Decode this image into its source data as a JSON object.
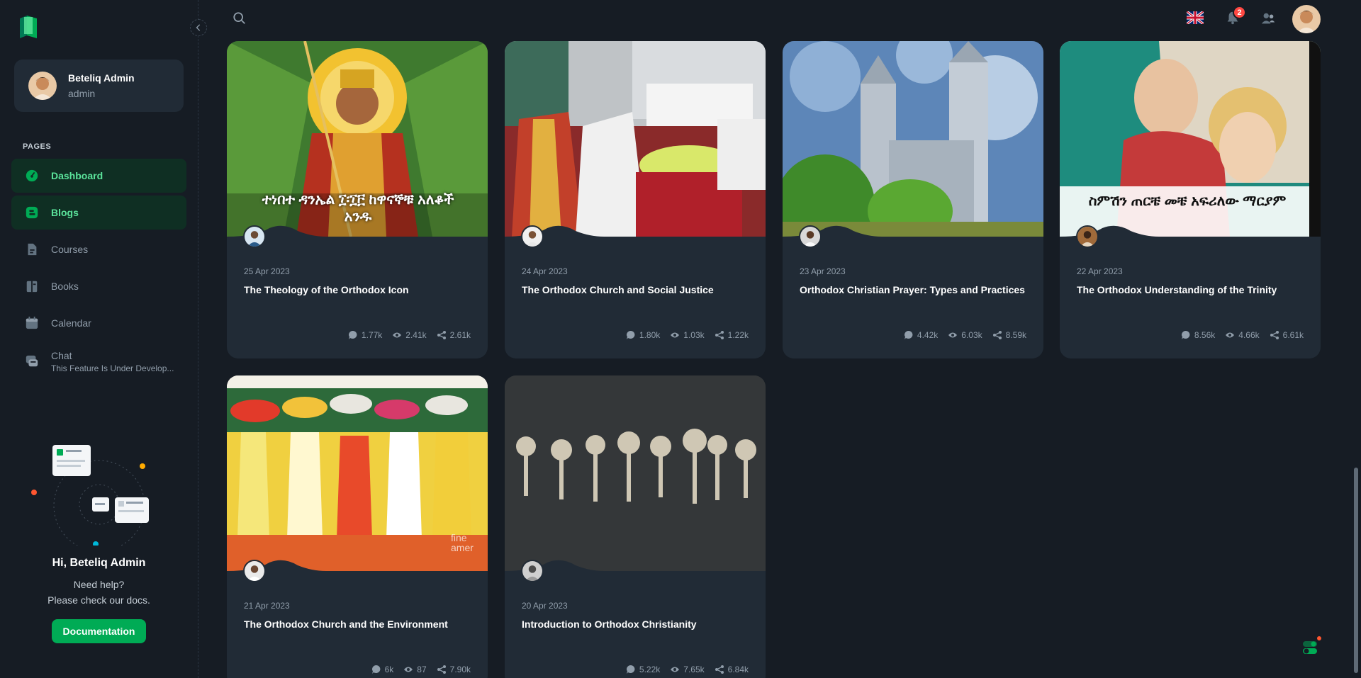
{
  "sidebar": {
    "account": {
      "name": "Beteliq Admin",
      "role": "admin"
    },
    "section_label": "PAGES",
    "items": [
      {
        "label": "Dashboard",
        "icon": "dashboard-icon",
        "active": true
      },
      {
        "label": "Blogs",
        "icon": "blog-icon",
        "active": true
      },
      {
        "label": "Courses",
        "icon": "courses-icon",
        "active": false
      },
      {
        "label": "Books",
        "icon": "books-icon",
        "active": false
      },
      {
        "label": "Calendar",
        "icon": "calendar-icon",
        "active": false
      },
      {
        "label": "Chat",
        "sub": "This Feature Is Under Develop...",
        "icon": "chat-icon",
        "active": false
      }
    ],
    "help": {
      "title": "Hi, Beteliq Admin",
      "line1": "Need help?",
      "line2": "Please check our docs.",
      "button": "Documentation"
    }
  },
  "topbar": {
    "notification_count": "2",
    "language": "English (UK flag)"
  },
  "posts": [
    {
      "date": "25 Apr 2023",
      "title": "The Theology of the Orthodox Icon",
      "comments": "1.77k",
      "views": "2.41k",
      "shares": "2.61k",
      "image_text": "ተነበተ ዳንኤል ፲፡፲፫ ከዋናኞቹ አለቆች አንዱ"
    },
    {
      "date": "24 Apr 2023",
      "title": "The Orthodox Church and Social Justice",
      "comments": "1.80k",
      "views": "1.03k",
      "shares": "1.22k"
    },
    {
      "date": "23 Apr 2023",
      "title": "Orthodox Christian Prayer: Types and Practices",
      "comments": "4.42k",
      "views": "6.03k",
      "shares": "8.59k"
    },
    {
      "date": "22 Apr 2023",
      "title": "The Orthodox Understanding of the Trinity",
      "comments": "8.56k",
      "views": "4.66k",
      "shares": "6.61k",
      "image_text": "ስምሽን ጠርቼ መቼ አፍሪለው ማርያም"
    },
    {
      "date": "21 Apr 2023",
      "title": "The Orthodox Church and the Environment",
      "comments": "6k",
      "views": "87",
      "shares": "7.90k",
      "image_text": "fine amer"
    },
    {
      "date": "20 Apr 2023",
      "title": "Introduction to Orthodox Christianity",
      "comments": "5.22k",
      "views": "7.65k",
      "shares": "6.84k"
    }
  ],
  "colors": {
    "accent": "#00ab55",
    "active_text": "#5be49b",
    "card": "#212b36",
    "bg": "#161c24",
    "badge": "#ff4842"
  }
}
